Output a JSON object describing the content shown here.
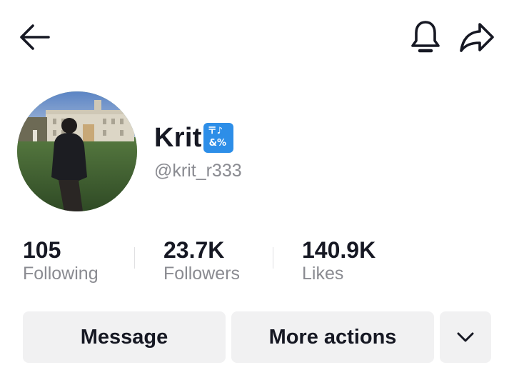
{
  "header": {
    "back_icon": "arrow-left-icon",
    "bell_icon": "bell-icon",
    "share_icon": "share-arrow-icon"
  },
  "profile": {
    "display_name": "Krit",
    "name_symbols": {
      "top": "〒♪",
      "bottom": "&%"
    },
    "username": "@krit_r333",
    "accent_color": "#2d8ee8"
  },
  "stats": [
    {
      "value": "105",
      "label": "Following"
    },
    {
      "value": "23.7K",
      "label": "Followers"
    },
    {
      "value": "140.9K",
      "label": "Likes"
    }
  ],
  "actions": {
    "message_label": "Message",
    "more_label": "More actions",
    "expand_icon": "chevron-down-icon"
  }
}
